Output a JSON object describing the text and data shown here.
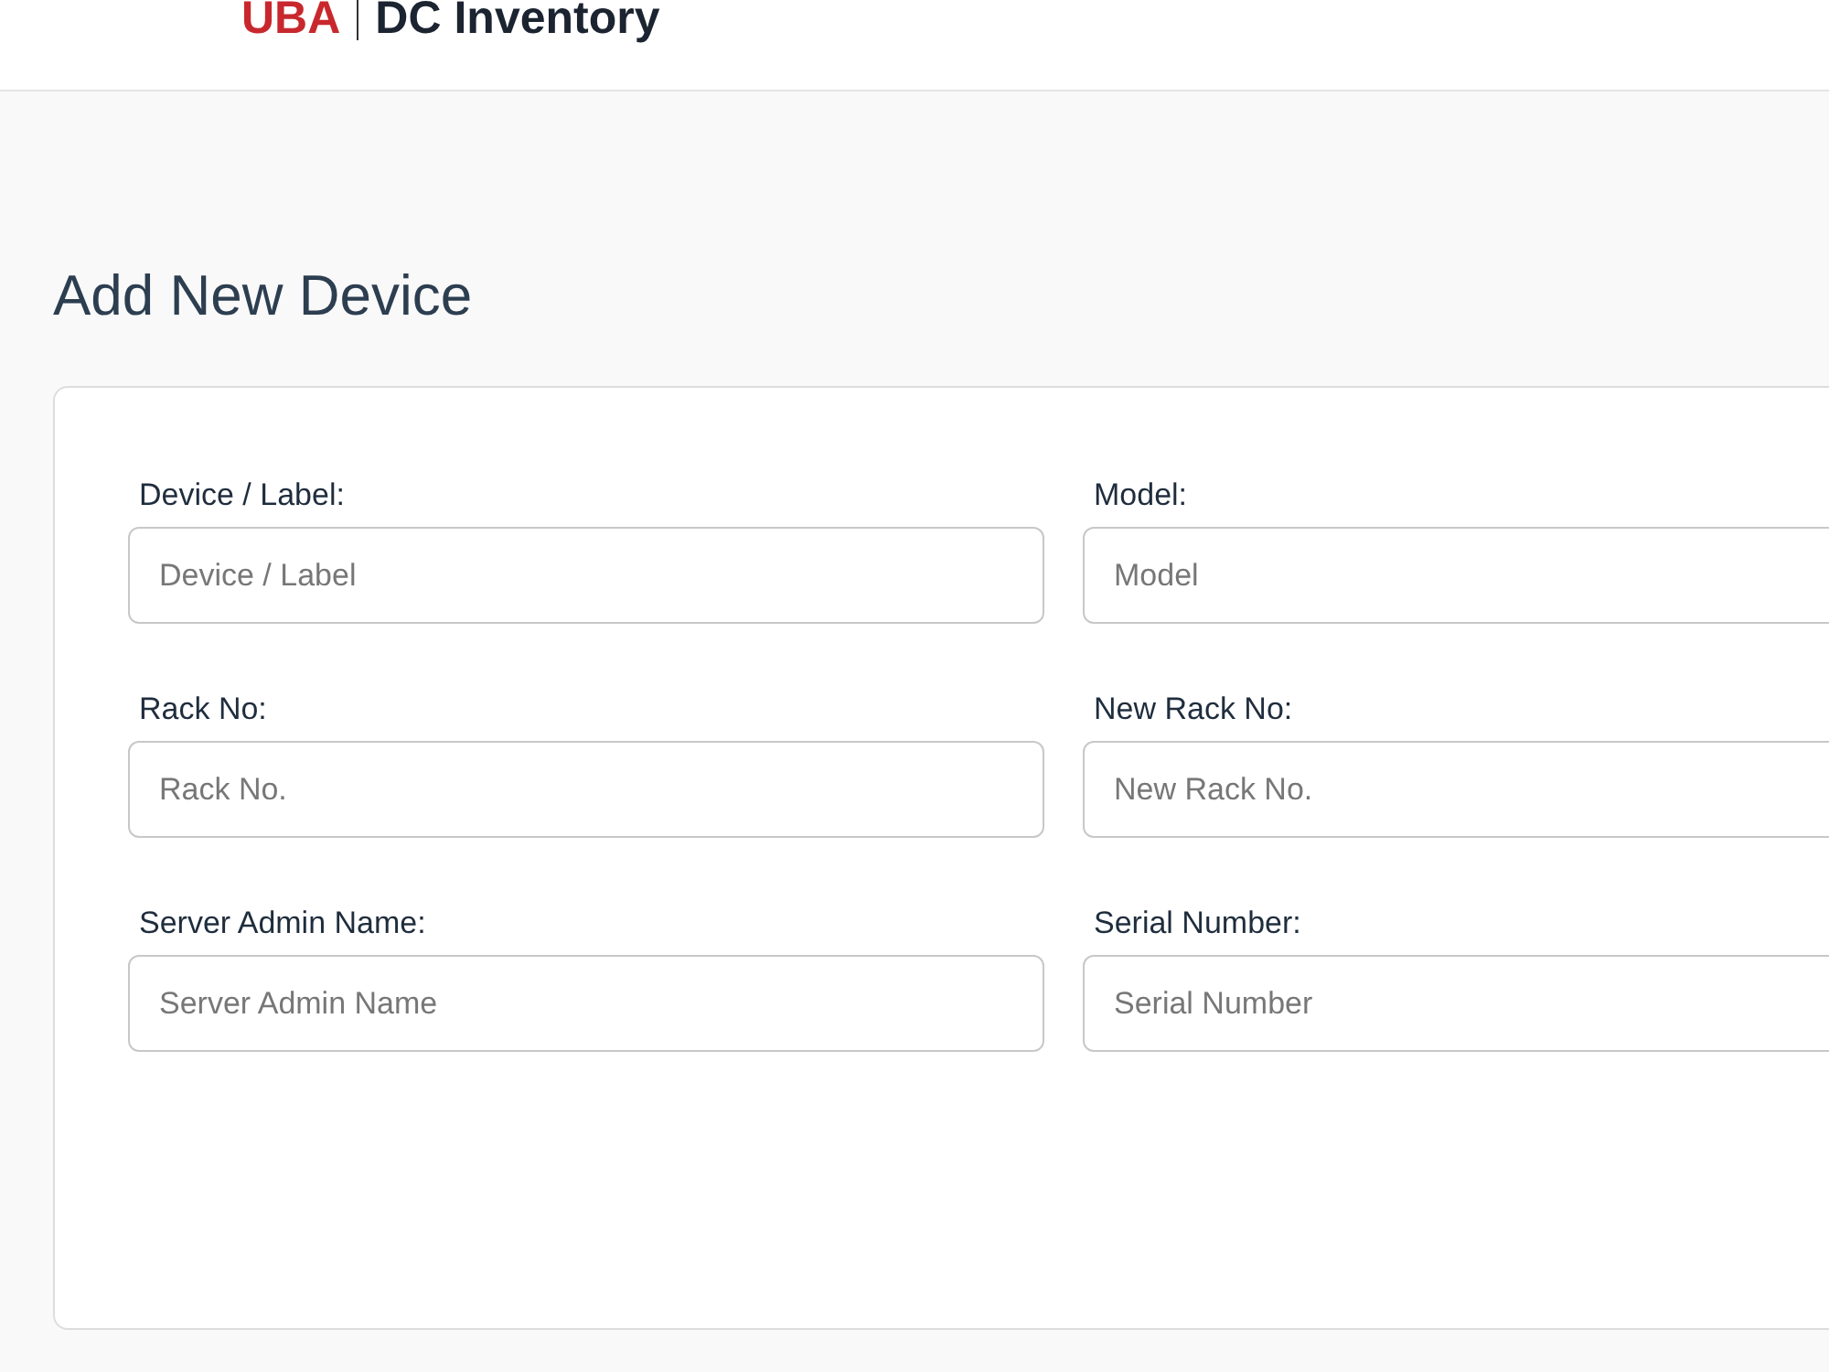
{
  "header": {
    "brand": "UBA",
    "title": "DC Inventory"
  },
  "page_title": "Add New Device",
  "fields": [
    {
      "label": "Device / Label:",
      "placeholder": "Device / Label"
    },
    {
      "label": "Model:",
      "placeholder": "Model"
    },
    {
      "label": "Rack No:",
      "placeholder": "Rack No."
    },
    {
      "label": "New Rack No:",
      "placeholder": "New Rack No."
    },
    {
      "label": "Server Admin Name:",
      "placeholder": "Server Admin Name"
    },
    {
      "label": "Serial Number:",
      "placeholder": "Serial Number"
    }
  ]
}
